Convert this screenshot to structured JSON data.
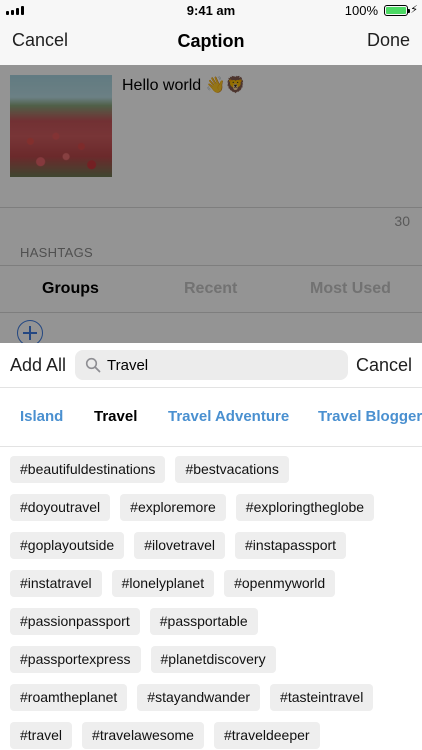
{
  "status_bar": {
    "time": "9:41 am",
    "battery_percent": "100%"
  },
  "nav": {
    "cancel": "Cancel",
    "title": "Caption",
    "done": "Done"
  },
  "caption": {
    "text": "Hello world 👋🦁",
    "char_count": "30"
  },
  "hashtags_label": "HASHTAGS",
  "segments": [
    {
      "label": "Groups",
      "active": true
    },
    {
      "label": "Recent",
      "active": false
    },
    {
      "label": "Most Used",
      "active": false
    }
  ],
  "search": {
    "add_all": "Add All",
    "value": "Travel",
    "placeholder": "Search",
    "cancel": "Cancel"
  },
  "filters": [
    {
      "label": "Island",
      "active": false
    },
    {
      "label": "Travel",
      "active": true
    },
    {
      "label": "Travel Adventure",
      "active": false
    },
    {
      "label": "Travel Blogger",
      "active": false
    }
  ],
  "hashtags": [
    [
      "#beautifuldestinations",
      "#bestvacations"
    ],
    [
      "#doyoutravel",
      "#exploremore",
      "#exploringtheglobe"
    ],
    [
      "#goplayoutside",
      "#ilovetravel",
      "#instapassport"
    ],
    [
      "#instatravel",
      "#lonelyplanet",
      "#openmyworld"
    ],
    [
      "#passionpassport",
      "#passportable"
    ],
    [
      "#passportexpress",
      "#planetdiscovery"
    ],
    [
      "#roamtheplanet",
      "#stayandwander",
      "#tasteintravel"
    ],
    [
      "#travel",
      "#travelawesome",
      "#traveldeeper"
    ]
  ],
  "colors": {
    "accent_blue": "#4a90d0",
    "battery_green": "#4cd964",
    "tag_bg": "#eeeeee"
  }
}
